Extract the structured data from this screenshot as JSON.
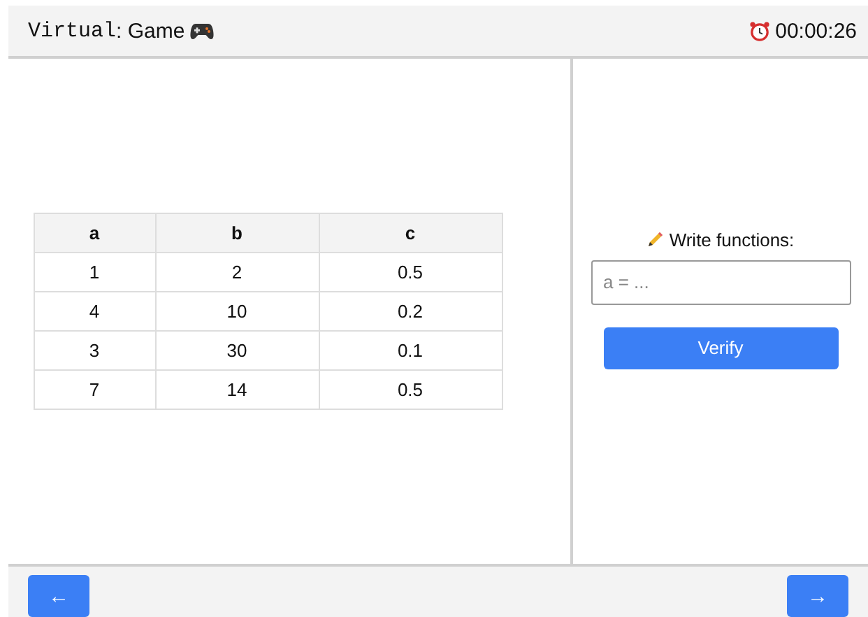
{
  "header": {
    "title_code": "Virtual",
    "title_text": ": Game",
    "timer": "00:00:26"
  },
  "table": {
    "columns": [
      "a",
      "b",
      "c"
    ],
    "rows": [
      [
        "1",
        "2",
        "0.5"
      ],
      [
        "4",
        "10",
        "0.2"
      ],
      [
        "3",
        "30",
        "0.1"
      ],
      [
        "7",
        "14",
        "0.5"
      ]
    ]
  },
  "answer": {
    "prompt": "Write functions:",
    "placeholder": "a = ...",
    "button": "Verify"
  },
  "footer": {
    "back": "←",
    "next": "→"
  }
}
